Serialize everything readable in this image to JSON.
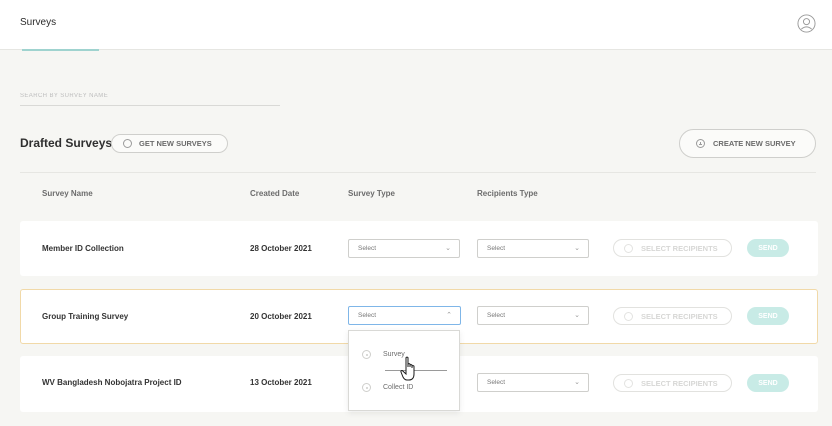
{
  "header": {
    "title": "Surveys"
  },
  "search": {
    "placeholder": "SEARCH BY SURVEY NAME"
  },
  "section": {
    "title": "Drafted Surveys",
    "get_new_label": "GET NEW SURVEYS",
    "create_new_label": "CREATE NEW SURVEY"
  },
  "table": {
    "columns": [
      "Survey Name",
      "Created Date",
      "Survey Type",
      "Recipients Type"
    ],
    "rows": [
      {
        "name": "Member ID Collection",
        "date": "28 October 2021",
        "survey_type": "Select",
        "recipients_type": "Select",
        "select_recipients": "SELECT RECIPIENTS",
        "send": "SEND"
      },
      {
        "name": "Group Training Survey",
        "date": "20 October 2021",
        "survey_type": "Select",
        "recipients_type": "Select",
        "select_recipients": "SELECT RECIPIENTS",
        "send": "SEND"
      },
      {
        "name": "WV Bangladesh Nobojatra Project ID",
        "date": "13 October 2021",
        "survey_type": "",
        "recipients_type": "Select",
        "select_recipients": "SELECT RECIPIENTS",
        "send": "SEND"
      }
    ]
  },
  "dropdown": {
    "options": [
      "Survey",
      "Collect ID"
    ]
  },
  "colors": {
    "accent": "#9fd3cf",
    "send_bg": "#c8ebe6",
    "active_border": "#f1d9a8",
    "focus_border": "#7fb6e8"
  }
}
